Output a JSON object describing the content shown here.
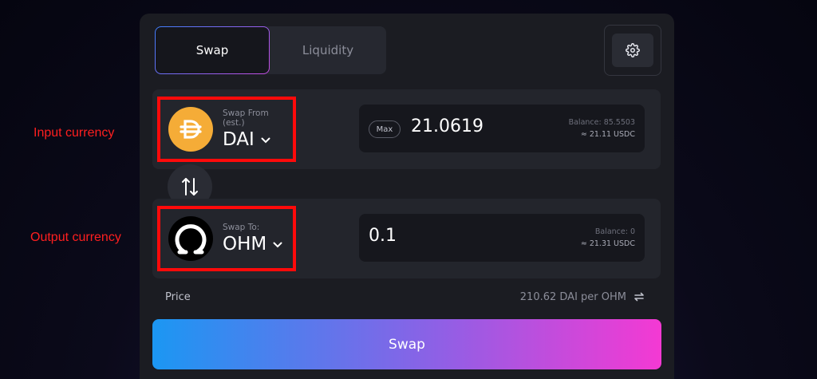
{
  "annotations": {
    "input": "Input currency",
    "output": "Output currency"
  },
  "tabs": [
    {
      "label": "Swap",
      "active": true
    },
    {
      "label": "Liquidity",
      "active": false
    }
  ],
  "from": {
    "label": "Swap From (est.)",
    "symbol": "DAI",
    "icon": "dai-coin-icon",
    "max_label": "Max",
    "amount": "21.0619",
    "balance": "Balance: 85.5503",
    "usd": "≈ 21.11 USDC"
  },
  "to": {
    "label": "Swap To:",
    "symbol": "OHM",
    "icon": "ohm-coin-icon",
    "amount": "0.1",
    "balance": "Balance: 0",
    "usd": "≈ 21.31 USDC"
  },
  "price": {
    "label": "Price",
    "value": "210.62 DAI per OHM"
  },
  "swap_button": "Swap",
  "colors": {
    "accent_start": "#1b97f3",
    "accent_end": "#f439d3",
    "annotation": "#ff1f1f",
    "dai": "#f5ac37"
  }
}
